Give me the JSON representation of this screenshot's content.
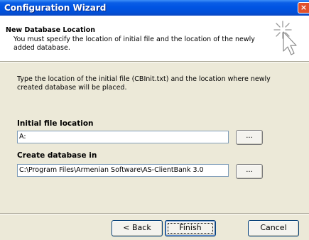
{
  "window": {
    "title": "Configuration Wizard",
    "close_label": "×"
  },
  "header": {
    "title": "New Database Location",
    "subtitle": "You must specify the location of initial file and the location of the newly added database."
  },
  "body": {
    "instructions": "Type the location of the initial file (CBInit.txt) and the location where newly created database will be placed."
  },
  "fields": {
    "initial_file": {
      "label": "Initial file location",
      "value": "A:",
      "browse_label": "..."
    },
    "database": {
      "label": "Create database in",
      "value": "C:\\Program Files\\Armenian Software\\AS-ClientBank 3.0",
      "browse_label": "..."
    }
  },
  "buttons": {
    "back": "< Back",
    "finish": "Finish",
    "cancel": "Cancel"
  },
  "colors": {
    "titlebar": "#0054e3",
    "dialog_bg": "#ece9d8",
    "close_button": "#e1502b"
  },
  "icons": {
    "wizard": "magic-wand-cursor-icon"
  }
}
